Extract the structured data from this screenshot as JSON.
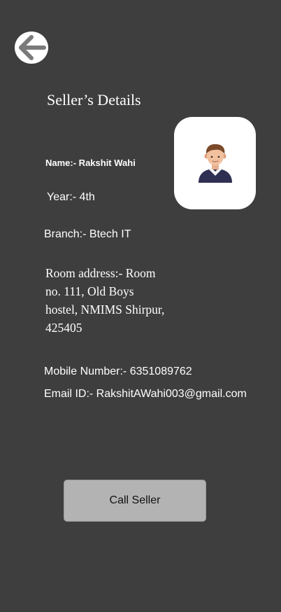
{
  "header": {
    "back_icon": "arrow-left-icon",
    "title": "Seller’s Details"
  },
  "seller": {
    "avatar_icon": "user-avatar-icon",
    "name": "Name:- Rakshit Wahi",
    "year": "Year:- 4th",
    "branch": "Branch:- Btech IT",
    "room_address": "Room address:- Room no. 111, Old Boys hostel, NMIMS Shirpur, 425405",
    "mobile": "Mobile Number:- 6351089762",
    "email": "Email ID:- RakshitAWahi003@gmail.com"
  },
  "actions": {
    "call_label": "Call Seller"
  },
  "colors": {
    "background": "#3e3e3e",
    "card": "#ffffff",
    "button": "#b3b3b3",
    "text": "#ffffff"
  }
}
